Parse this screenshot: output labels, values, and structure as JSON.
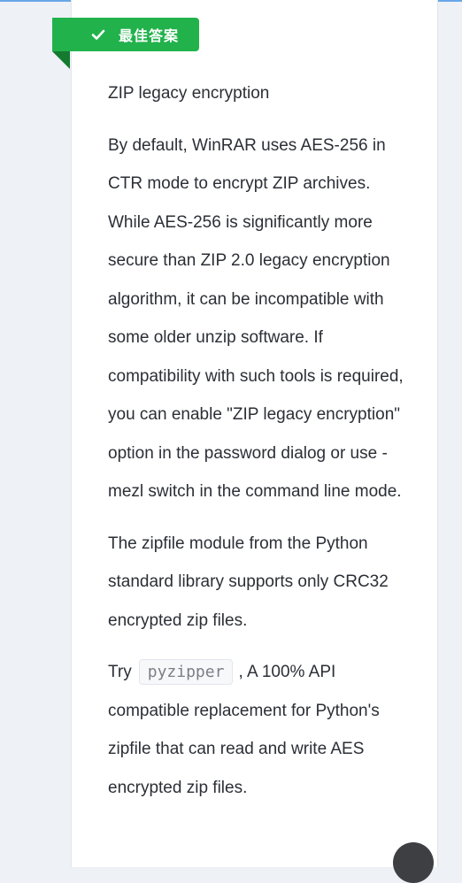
{
  "badge": {
    "label": "最佳答案",
    "icon": "checkmark-icon",
    "color": "#22b24c"
  },
  "answer": {
    "title": "ZIP legacy encryption",
    "paragraph1": "By default, WinRAR uses AES-256 in CTR mode to encrypt ZIP archives. While AES-256 is significantly more secure than ZIP 2.0 legacy encryption algorithm, it can be incompatible with some older unzip software. If compatibility with such tools is required, you can enable \"ZIP legacy encryption\" option in the password dialog or use -mezl switch in the command line mode.",
    "paragraph2": "The zipfile module from the Python standard library supports only CRC32 encrypted zip files.",
    "paragraph3_prefix": "Try",
    "paragraph3_code": "pyzipper",
    "paragraph3_suffix": ", A 100% API compatible replacement for Python's zipfile that can read and write AES encrypted zip files."
  },
  "colors": {
    "accent_line": "#6aa6e8",
    "text": "#2b2f36"
  }
}
